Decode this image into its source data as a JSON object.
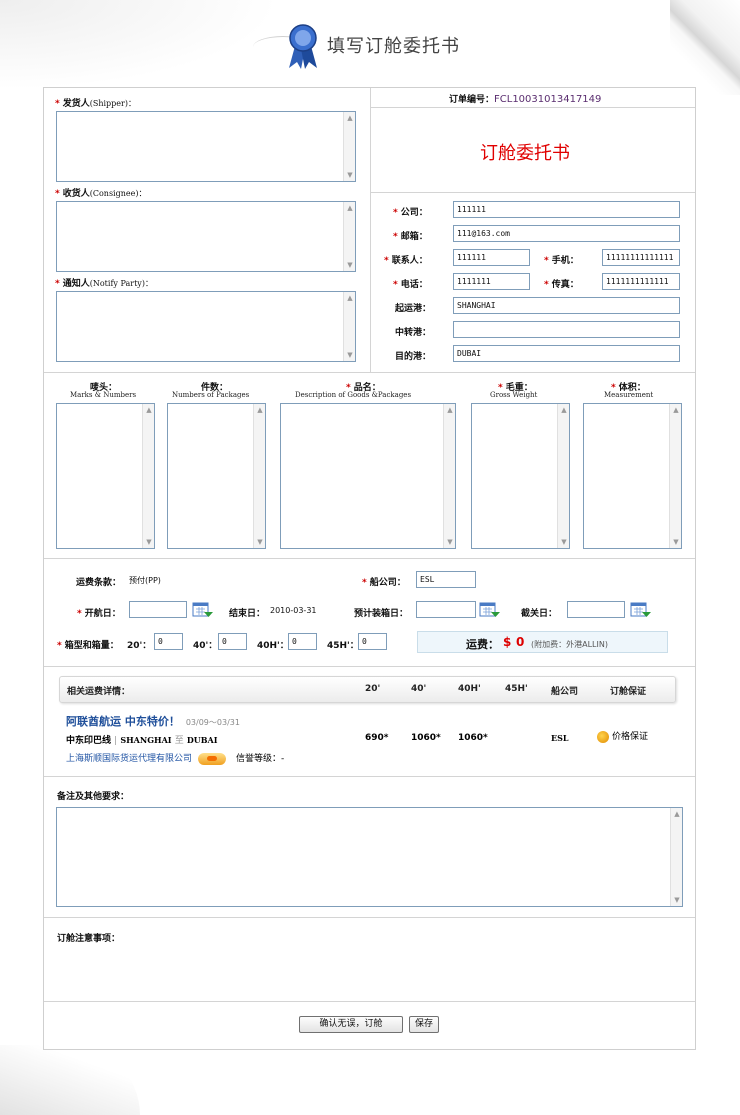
{
  "page": {
    "title": "填写订舱委托书"
  },
  "order": {
    "label": "订单编号：",
    "number": "FCL10031013417149"
  },
  "form_title": "订舱委托书",
  "parties": {
    "shipper": {
      "label": "发货人",
      "en": "(Shipper)："
    },
    "consignee": {
      "label": "收货人",
      "en": "(Consignee)："
    },
    "notify": {
      "label": "通知人",
      "en": "(Notify Party)："
    }
  },
  "contact": {
    "company_label": "公司：",
    "company": "111111",
    "email_label": "邮箱：",
    "email": "111@163.com",
    "person_label": "联系人：",
    "person": "111111",
    "mobile_label": "手机：",
    "mobile": "11111111111111",
    "phone_label": "电话：",
    "phone": "1111111",
    "fax_label": "传真：",
    "fax": "1111111111111",
    "pol_label": "起运港：",
    "pol": "SHANGHAI",
    "transit_label": "中转港：",
    "transit": "",
    "pod_label": "目的港：",
    "pod": "DUBAI"
  },
  "cargo": {
    "marks": {
      "label": "唛头：",
      "en": "Marks & Numbers"
    },
    "packages": {
      "label": "件数：",
      "en": "Numbers of Packages"
    },
    "goods": {
      "label": "品名：",
      "en": "Description of Goods &Packages"
    },
    "weight": {
      "label": "毛重：",
      "en": "Gross Weight"
    },
    "volume": {
      "label": "体积：",
      "en": "Measurement"
    }
  },
  "shipping": {
    "terms_label": "运费条款：",
    "terms": "预付(PP)",
    "carrier_label": "船公司：",
    "carrier": "ESL",
    "sail_label": "开航日：",
    "sail": "",
    "end_label": "结束日：",
    "end": "2010-03-31",
    "load_label": "预计装箱日：",
    "load": "",
    "cutoff_label": "截关日：",
    "cutoff": "",
    "container_label": "箱型和箱量：",
    "c20_label": "20'：",
    "c20": "0",
    "c40_label": "40'：",
    "c40": "0",
    "c40h_label": "40H'：",
    "c40h": "0",
    "c45h_label": "45H'：",
    "c45h": "0",
    "freight_label": "运费：",
    "freight_currency": "$",
    "freight": "0",
    "freight_note": "(附加费：外港ALLIN)"
  },
  "quote": {
    "headers": {
      "detail": "相关运费详情：",
      "c20": "20'",
      "c40": "40'",
      "c40h": "40H'",
      "c45h": "45H'",
      "carrier": "船公司",
      "guarantee": "订舱保证"
    },
    "title": "阿联酋航运  中东特价！",
    "date": "03/09～03/31",
    "route_name": "中东印巴线",
    "route_sep1": "|",
    "route_from": "SHANGHAI",
    "route_to_word": "至",
    "route_to": "DUBAI",
    "agent": "上海斯顺国际货运代理有限公司",
    "credit_label": "信誉等级：",
    "credit": "-",
    "p20": "690*",
    "p40": "1060*",
    "p40h": "1060*",
    "p45h": "",
    "carrier": "ESL",
    "guarantee": "价格保证"
  },
  "remarks": {
    "label": "备注及其他要求："
  },
  "notice": {
    "label": "订舱注意事项："
  },
  "buttons": {
    "confirm": "确认无误，订舱",
    "save": "保存"
  },
  "colors": {
    "required": "#cc0000",
    "title_red": "#e00000",
    "link": "#1f4f9a"
  }
}
